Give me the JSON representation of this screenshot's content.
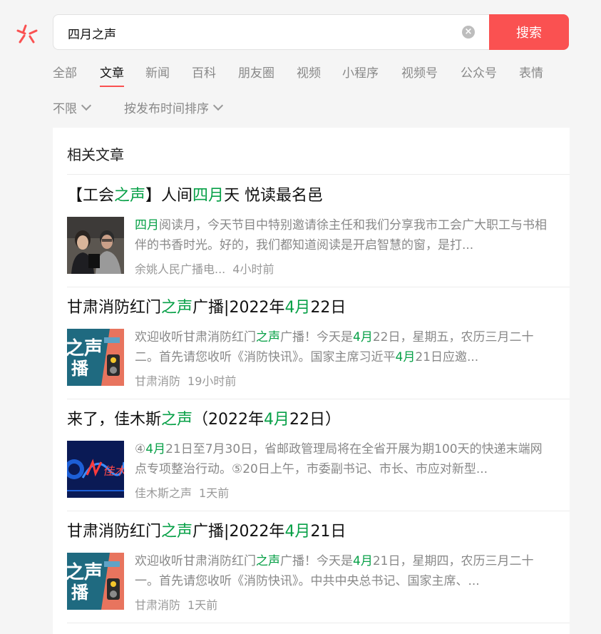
{
  "search": {
    "query": "四月之声",
    "button_label": "搜索"
  },
  "tabs": [
    {
      "label": "全部"
    },
    {
      "label": "文章"
    },
    {
      "label": "新闻"
    },
    {
      "label": "百科"
    },
    {
      "label": "朋友圈"
    },
    {
      "label": "视频"
    },
    {
      "label": "小程序"
    },
    {
      "label": "视频号"
    },
    {
      "label": "公众号"
    },
    {
      "label": "表情"
    }
  ],
  "active_tab": "文章",
  "filters": {
    "time": "不限",
    "sort": "按发布时间排序"
  },
  "section_title": "相关文章",
  "articles": [
    {
      "title_parts": [
        "【工会",
        "之声",
        "】人间",
        "四月",
        "天 悦读最名邑"
      ],
      "desc_parts": [
        "四月",
        "阅读月，今天节目中特别邀请徐主任和我们分享我市工会广大职工与书相伴的书香时光。好的，我们都知道阅读是开启智慧的窗，是打..."
      ],
      "source": "余姚人民广播电...",
      "time": "4小时前"
    },
    {
      "title_parts": [
        "甘肃消防红门",
        "之声",
        "广播|2022年",
        "4月",
        "22日"
      ],
      "desc_parts": [
        "欢迎收听甘肃消防红门",
        "之声",
        "广播！今天是",
        "4月",
        "22日，星期五，农历三月二十二。首先请您收听《消防快讯》。国家主席习近平",
        "4月",
        "21日应邀..."
      ],
      "source": "甘肃消防",
      "time": "19小时前"
    },
    {
      "title_parts": [
        "来了，佳木斯",
        "之声",
        "（2022年",
        "4月",
        "22日）"
      ],
      "desc_parts": [
        "④",
        "4月",
        "21日至7月30日，省邮政管理局将在全省开展为期100天的快递末端网点专项整治行动。⑤20日上午，市委副书记、市长、市应对新型..."
      ],
      "source": "佳木斯之声",
      "time": "1天前"
    },
    {
      "title_parts": [
        "甘肃消防红门",
        "之声",
        "广播|2022年",
        "4月",
        "21日"
      ],
      "desc_parts": [
        "欢迎收听甘肃消防红门",
        "之声",
        "广播！今天是",
        "4月",
        "21日，星期四，农历三月二十一。首先请您收听《消防快讯》。中共中央总书记、国家主席、..."
      ],
      "source": "甘肃消防",
      "time": "1天前"
    }
  ],
  "thumb_text": {
    "zhisheng": "之声",
    "guangbo": "播",
    "script_logo": "佳木"
  },
  "colors": {
    "accent": "#fa5151",
    "highlight": "#07a047",
    "muted": "#888888"
  },
  "icons": {
    "logo": "weixin-search-logo",
    "clear": "clear-icon",
    "chevron": "chevron-down-icon"
  }
}
